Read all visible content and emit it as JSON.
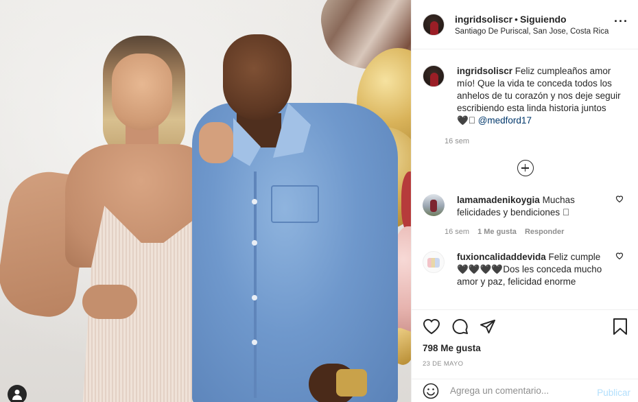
{
  "post": {
    "username": "ingridsoliscr",
    "follow_status": "Siguiendo",
    "location": "Santiago De Puriscal, San Jose, Costa Rica",
    "more_icon": "more-horizontal-icon"
  },
  "caption": {
    "username": "ingridsoliscr",
    "text": "Feliz cumpleaños amor mío! Que la vida te conceda todos los anhelos de tu corazón y nos deje seguir escribiendo esta linda historia juntos 🖤\u0000",
    "mention": "@medford17",
    "time": "16 sem"
  },
  "comments": [
    {
      "username": "lamamadenikoygia",
      "text": "Muchas felicidades y bendiciones \u0000",
      "time": "16 sem",
      "likes": "1 Me gusta",
      "reply": "Responder"
    },
    {
      "username": "fuxioncalidaddevida",
      "text": "Feliz cumple 🖤🖤🖤🖤Dos les conceda mucho amor y paz, felicidad enorme"
    }
  ],
  "actions": {
    "likes": "798 Me gusta",
    "date": "23 DE MAYO"
  },
  "add_comment": {
    "placeholder": "Agrega un comentario...",
    "publish_label": "Publicar"
  },
  "colors": {
    "text": "#262626",
    "muted": "#8e8e8e",
    "mention": "#00376b",
    "publish_disabled": "#b2dffc",
    "border": "#efefef"
  }
}
